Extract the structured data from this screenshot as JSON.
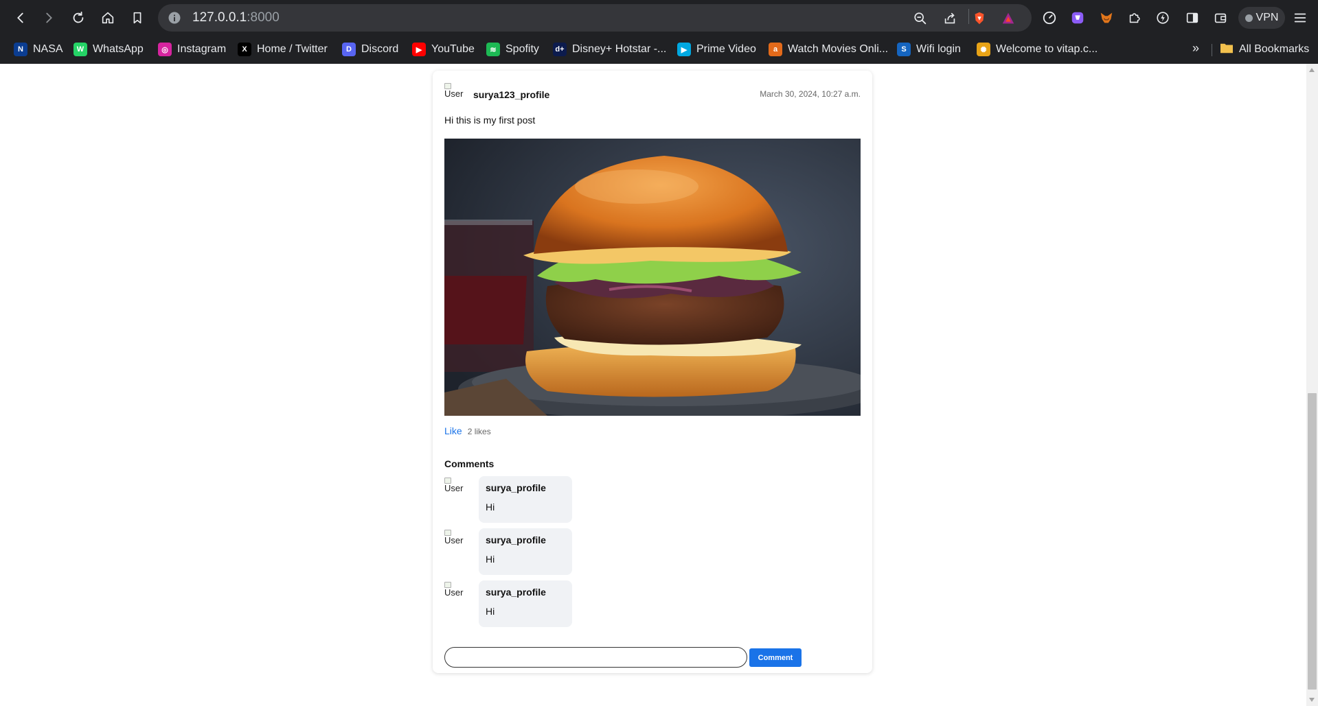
{
  "browser": {
    "url_host": "127.0.0.1",
    "url_port": ":8000",
    "vpn_label": "VPN",
    "bookmarks": [
      {
        "label": "NASA",
        "color": "#0b3d91",
        "glyph": "N"
      },
      {
        "label": "WhatsApp",
        "color": "#25d366",
        "glyph": "W"
      },
      {
        "label": "Instagram",
        "color": "#d6249f",
        "glyph": "◎"
      },
      {
        "label": "Home / Twitter",
        "color": "#000000",
        "glyph": "X"
      },
      {
        "label": "Discord",
        "color": "#5865f2",
        "glyph": "D"
      },
      {
        "label": "YouTube",
        "color": "#ff0000",
        "glyph": "▶"
      },
      {
        "label": "Spofity",
        "color": "#1db954",
        "glyph": "≋"
      },
      {
        "label": "Disney+ Hotstar -...",
        "color": "#0c1b4d",
        "glyph": "d+"
      },
      {
        "label": "Prime Video",
        "color": "#00a8e1",
        "glyph": "▶"
      },
      {
        "label": "Watch Movies Onli...",
        "color": "#e36a1a",
        "glyph": "a"
      },
      {
        "label": "Wifi login",
        "color": "#1565c0",
        "glyph": "S"
      },
      {
        "label": "Welcome to vitap.c...",
        "color": "#e8a317",
        "glyph": "✺"
      }
    ],
    "more_label": "»",
    "all_bookmarks_label": "All Bookmarks"
  },
  "post": {
    "avatar_alt": "User",
    "username": "surya123_profile",
    "timestamp": "March 30, 2024, 10:27 a.m.",
    "text": "Hi this is my first post",
    "image_subject": "burger",
    "like_label": "Like",
    "likes_count": "2 likes"
  },
  "comments": {
    "title": "Comments",
    "items": [
      {
        "avatar_alt": "User",
        "username": "surya_profile",
        "text": "Hi"
      },
      {
        "avatar_alt": "User",
        "username": "surya_profile",
        "text": "Hi"
      },
      {
        "avatar_alt": "User",
        "username": "surya_profile",
        "text": "Hi"
      }
    ],
    "input_value": "",
    "submit_label": "Comment"
  },
  "colors": {
    "link_blue": "#1a73e8",
    "chrome_dark": "#202124",
    "bubble_bg": "#f0f2f5"
  }
}
